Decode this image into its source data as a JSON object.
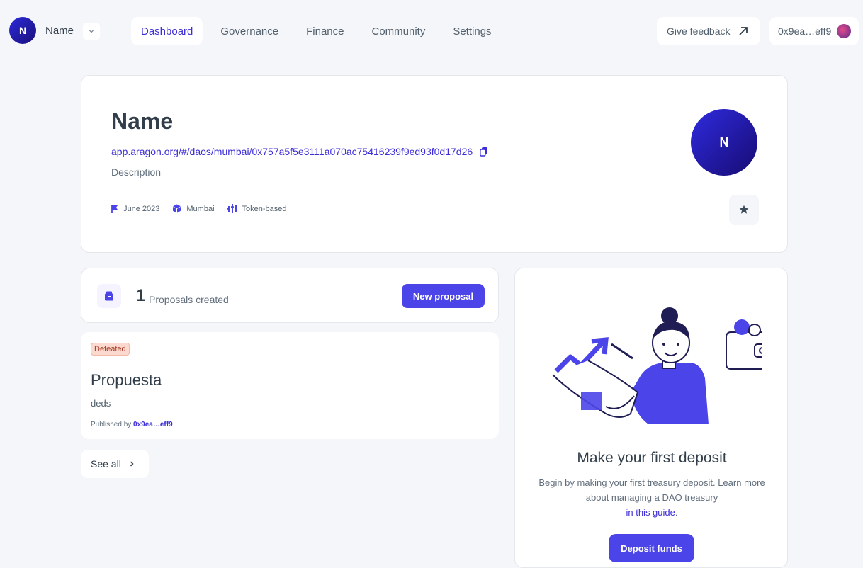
{
  "header": {
    "avatar_letter": "N",
    "dao_name": "Name",
    "nav": [
      {
        "label": "Dashboard",
        "active": true
      },
      {
        "label": "Governance"
      },
      {
        "label": "Finance"
      },
      {
        "label": "Community"
      },
      {
        "label": "Settings"
      }
    ],
    "feedback_label": "Give feedback",
    "wallet_address": "0x9ea…eff9"
  },
  "dao": {
    "title": "Name",
    "url": "app.aragon.org/#/daos/mumbai/0x757a5f5e3111a070ac75416239f9ed93f0d17d26",
    "description": "Description",
    "created": "June 2023",
    "network": "Mumbai",
    "governance": "Token-based",
    "avatar_letter": "N"
  },
  "proposals": {
    "count": "1",
    "count_label": "Proposals created",
    "new_button": "New proposal",
    "items": [
      {
        "status": "Defeated",
        "title": "Propuesta",
        "description": "deds",
        "published_prefix": "Published by",
        "author": "0x9ea…eff9"
      }
    ],
    "see_all": "See all"
  },
  "deposit": {
    "title": "Make your first deposit",
    "text": "Begin by making your first treasury deposit. Learn more about managing a DAO treasury",
    "link": "in this guide",
    "button": "Deposit funds"
  },
  "colors": {
    "accent": "#3c2dd6",
    "button": "#4b45e9",
    "background": "#f5f6f9",
    "defeated_bg": "#fcd9cf"
  }
}
